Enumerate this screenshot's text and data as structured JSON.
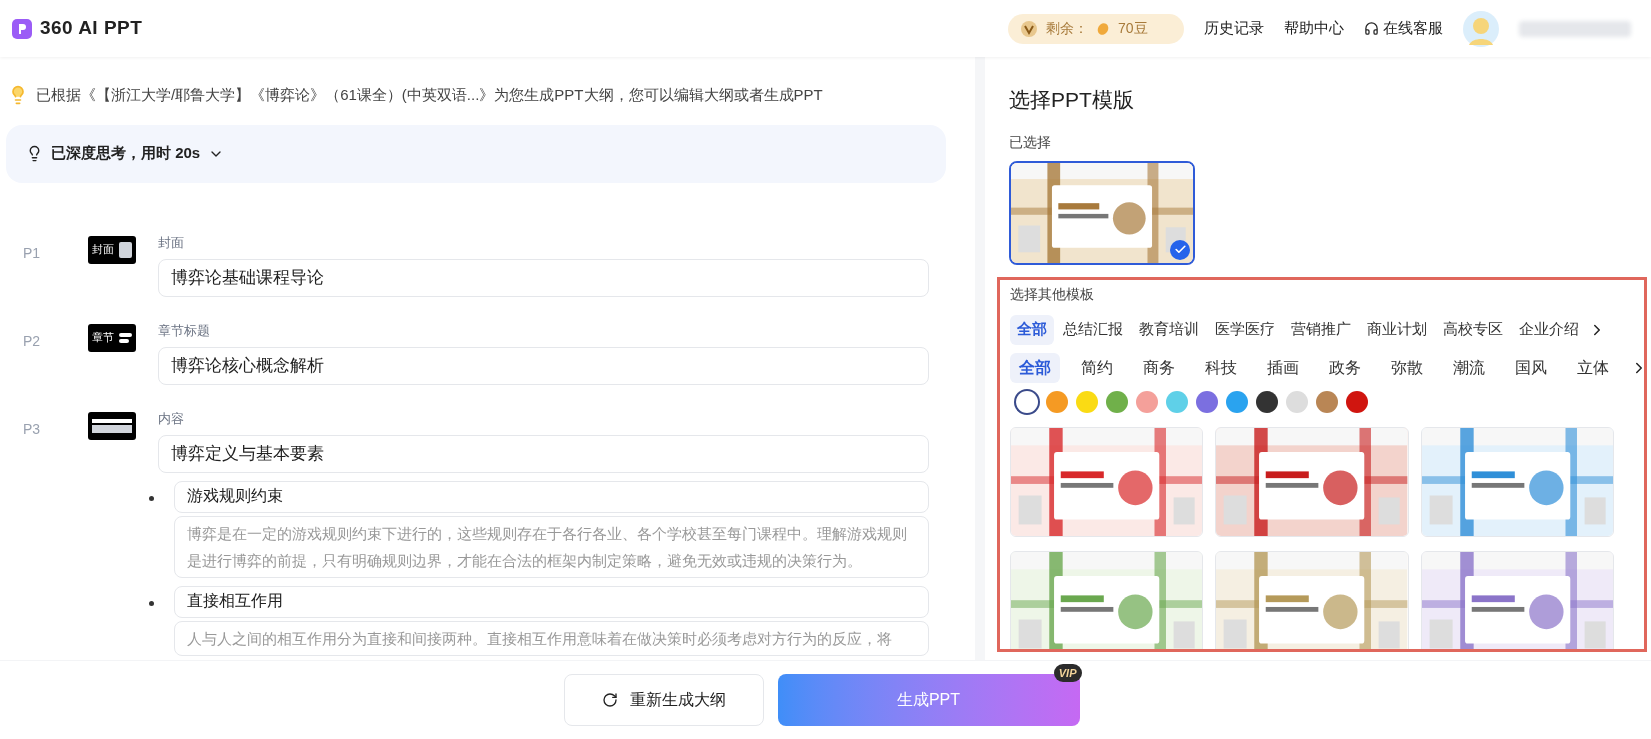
{
  "header": {
    "logo_text": "360 AI PPT",
    "balance": {
      "label": "剩余：",
      "amount": "70豆"
    },
    "links": [
      {
        "label": "历史记录",
        "kind": "text"
      },
      {
        "label": "帮助中心",
        "kind": "text"
      },
      {
        "label": "在线客服",
        "kind": "support"
      }
    ]
  },
  "outline": {
    "notice": "已根据《【浙江大学/耶鲁大学】《博弈论》（61课全）(中英双语...》为您生成PPT大纲，您可以编辑大纲或者生成PPT",
    "thinking": {
      "label": "已深度思考，用时 20s",
      "expanded": false
    },
    "pages": [
      {
        "number": "P1",
        "kind": "cover",
        "icon_text": "封面",
        "type_label": "封面",
        "title": "博弈论基础课程导论"
      },
      {
        "number": "P2",
        "kind": "section",
        "icon_text": "章节",
        "type_label": "章节标题",
        "title": "博弈论核心概念解析"
      },
      {
        "number": "P3",
        "kind": "content",
        "type_label": "内容",
        "title": "博弈定义与基本要素",
        "children": [
          {
            "title": "游戏规则约束",
            "description": "博弈是在一定的游戏规则约束下进行的，这些规则存在于各行各业、各个学校甚至每门课程中。理解游戏规则是进行博弈的前提，只有明确规则边界，才能在合法的框架内制定策略，避免无效或违规的决策行为。"
          },
          {
            "title": "直接相互作用",
            "description": "人与人之间的相互作用分为直接和间接两种。直接相互作用意味着在做决策时必须考虑对方行为的反应，将"
          }
        ]
      }
    ]
  },
  "templates": {
    "title": "选择PPT模版",
    "selected_label": "已选择",
    "selected_template": {
      "kind": "picture",
      "selected": true
    },
    "other_label": "选择其他模板",
    "categories": [
      {
        "label": "全部",
        "selected": true
      },
      {
        "label": "总结汇报",
        "selected": false
      },
      {
        "label": "教育培训",
        "selected": false
      },
      {
        "label": "医学医疗",
        "selected": false
      },
      {
        "label": "营销推广",
        "selected": false
      },
      {
        "label": "商业计划",
        "selected": false
      },
      {
        "label": "高校专区",
        "selected": false
      },
      {
        "label": "企业介绍",
        "selected": false
      }
    ],
    "styles": [
      {
        "label": "全部",
        "selected": true
      },
      {
        "label": "简约",
        "selected": false
      },
      {
        "label": "商务",
        "selected": false
      },
      {
        "label": "科技",
        "selected": false
      },
      {
        "label": "插画",
        "selected": false
      },
      {
        "label": "政务",
        "selected": false
      },
      {
        "label": "弥散",
        "selected": false
      },
      {
        "label": "潮流",
        "selected": false
      },
      {
        "label": "国风",
        "selected": false
      },
      {
        "label": "立体",
        "selected": false
      }
    ],
    "colors": [
      {
        "color": "#ffffff",
        "selected": true
      },
      {
        "color": "#f59a23",
        "selected": false
      },
      {
        "color": "#fadb14",
        "selected": false
      },
      {
        "color": "#70b04a",
        "selected": false
      },
      {
        "color": "#f4a09a",
        "selected": false
      },
      {
        "color": "#5fd0e8",
        "selected": false
      },
      {
        "color": "#7b6fe0",
        "selected": false
      },
      {
        "color": "#2aa3ef",
        "selected": false
      },
      {
        "color": "#333333",
        "selected": false
      },
      {
        "color": "#dddddd",
        "selected": false
      },
      {
        "color": "#b98655",
        "selected": false
      },
      {
        "color": "#d0150f",
        "selected": false
      }
    ],
    "items": [
      {
        "kind": "picture"
      },
      {
        "kind": "picture"
      },
      {
        "kind": "picture"
      },
      {
        "kind": "picture"
      },
      {
        "kind": "picture"
      },
      {
        "kind": "picture"
      }
    ]
  },
  "actions": {
    "regenerate": "重新生成大纲",
    "generate": "生成PPT",
    "generate_badge": "VIP"
  }
}
